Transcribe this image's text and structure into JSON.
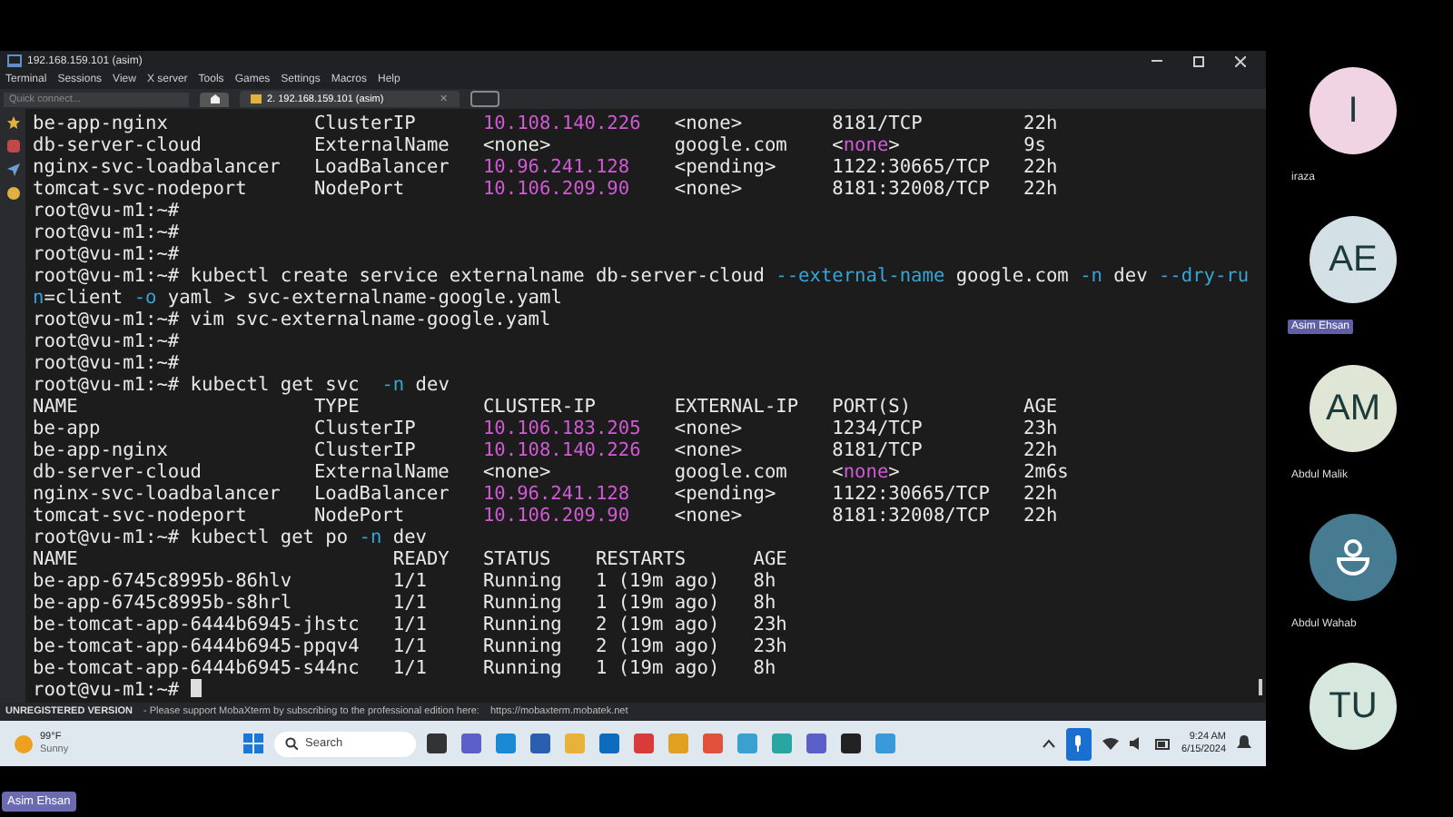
{
  "window": {
    "title": "192.168.159.101 (asim)",
    "menu": [
      "Terminal",
      "Sessions",
      "View",
      "X server",
      "Tools",
      "Games",
      "Settings",
      "Macros",
      "Help"
    ],
    "quick_connect": {
      "placeholder": "Quick connect..."
    },
    "tabs": [
      {
        "label": "2. 192.168.159.101 (asim)",
        "close": "✕",
        "selected": true
      }
    ],
    "terminal": {
      "lines": [
        [
          {
            "text": "be-app-nginx             ClusterIP      ",
            "kind": "plain"
          },
          {
            "text": "10.108.140.226",
            "kind": "ip"
          },
          {
            "text": "   <none>        8181/TCP         22h",
            "kind": "plain"
          }
        ],
        [
          {
            "text": "db-server-cloud          ExternalName   <none>           google.com    <",
            "kind": "plain"
          },
          {
            "text": "none",
            "kind": "ip"
          },
          {
            "text": ">           9s",
            "kind": "plain"
          }
        ],
        [
          {
            "text": "nginx-svc-loadbalancer   LoadBalancer   ",
            "kind": "plain"
          },
          {
            "text": "10.96.241.128",
            "kind": "ip"
          },
          {
            "text": "    <pending>     1122:30665/TCP   22h",
            "kind": "plain"
          }
        ],
        [
          {
            "text": "tomcat-svc-nodeport      NodePort       ",
            "kind": "plain"
          },
          {
            "text": "10.106.209.90",
            "kind": "ip"
          },
          {
            "text": "    <none>        8181:32008/TCP   22h",
            "kind": "plain"
          }
        ],
        [
          {
            "text": "root@vu-m1:~#",
            "kind": "plain"
          }
        ],
        [
          {
            "text": "root@vu-m1:~#",
            "kind": "plain"
          }
        ],
        [
          {
            "text": "root@vu-m1:~#",
            "kind": "plain"
          }
        ],
        [
          {
            "text": "root@vu-m1:~# kubectl create service externalname db-server-cloud ",
            "kind": "plain"
          },
          {
            "text": "--external-name",
            "kind": "flag"
          },
          {
            "text": " google.com ",
            "kind": "plain"
          },
          {
            "text": "-n",
            "kind": "flag"
          },
          {
            "text": " dev ",
            "kind": "plain"
          },
          {
            "text": "--dry-ru",
            "kind": "flag"
          }
        ],
        [
          {
            "text": "n",
            "kind": "flag"
          },
          {
            "text": "=client ",
            "kind": "plain"
          },
          {
            "text": "-o",
            "kind": "flag"
          },
          {
            "text": " yaml > svc-externalname-google.yaml",
            "kind": "plain"
          }
        ],
        [
          {
            "text": "root@vu-m1:~# vim svc-externalname-google.yaml",
            "kind": "plain"
          }
        ],
        [
          {
            "text": "root@vu-m1:~#",
            "kind": "plain"
          }
        ],
        [
          {
            "text": "root@vu-m1:~#",
            "kind": "plain"
          }
        ],
        [
          {
            "text": "root@vu-m1:~# kubectl get svc  ",
            "kind": "plain"
          },
          {
            "text": "-n",
            "kind": "flag"
          },
          {
            "text": " dev",
            "kind": "plain"
          }
        ],
        [
          {
            "text": "NAME                     TYPE           CLUSTER-IP       EXTERNAL-IP   PORT(S)          AGE",
            "kind": "plain"
          }
        ],
        [
          {
            "text": "be-app                   ClusterIP      ",
            "kind": "plain"
          },
          {
            "text": "10.106.183.205",
            "kind": "ip"
          },
          {
            "text": "   <none>        1234/TCP         23h",
            "kind": "plain"
          }
        ],
        [
          {
            "text": "be-app-nginx             ClusterIP      ",
            "kind": "plain"
          },
          {
            "text": "10.108.140.226",
            "kind": "ip"
          },
          {
            "text": "   <none>        8181/TCP         22h",
            "kind": "plain"
          }
        ],
        [
          {
            "text": "db-server-cloud          ExternalName   <none>           google.com    <",
            "kind": "plain"
          },
          {
            "text": "none",
            "kind": "ip"
          },
          {
            "text": ">           2m6s",
            "kind": "plain"
          }
        ],
        [
          {
            "text": "nginx-svc-loadbalancer   LoadBalancer   ",
            "kind": "plain"
          },
          {
            "text": "10.96.241.128",
            "kind": "ip"
          },
          {
            "text": "    <pending>     1122:30665/TCP   22h",
            "kind": "plain"
          }
        ],
        [
          {
            "text": "tomcat-svc-nodeport      NodePort       ",
            "kind": "plain"
          },
          {
            "text": "10.106.209.90",
            "kind": "ip"
          },
          {
            "text": "    <none>        8181:32008/TCP   22h",
            "kind": "plain"
          }
        ],
        [
          {
            "text": "root@vu-m1:~# kubectl get po ",
            "kind": "plain"
          },
          {
            "text": "-n",
            "kind": "flag"
          },
          {
            "text": " dev",
            "kind": "plain"
          }
        ],
        [
          {
            "text": "NAME                            READY   STATUS    RESTARTS      AGE",
            "kind": "plain"
          }
        ],
        [
          {
            "text": "be-app-6745c8995b-86hlv         1/1     Running   1 (19m ago)   8h",
            "kind": "plain"
          }
        ],
        [
          {
            "text": "be-app-6745c8995b-s8hrl         1/1     Running   1 (19m ago)   8h",
            "kind": "plain"
          }
        ],
        [
          {
            "text": "be-tomcat-app-6444b6945-jhstc   1/1     Running   2 (19m ago)   23h",
            "kind": "plain"
          }
        ],
        [
          {
            "text": "be-tomcat-app-6444b6945-ppqv4   1/1     Running   2 (19m ago)   23h",
            "kind": "plain"
          }
        ],
        [
          {
            "text": "be-tomcat-app-6444b6945-s44nc   1/1     Running   1 (19m ago)   8h",
            "kind": "plain"
          }
        ],
        [
          {
            "text": "root@vu-m1:~# ",
            "kind": "plain"
          },
          {
            "kind": "cursor"
          }
        ]
      ]
    },
    "status_bar": {
      "label": "UNREGISTERED VERSION",
      "message": "-  Please support MobaXterm by subscribing to the professional edition here:",
      "link": "https://mobaxterm.mobatek.net"
    }
  },
  "taskbar": {
    "weather": {
      "temperature": "99°F",
      "condition": "Sunny"
    },
    "search": {
      "placeholder": "Search"
    },
    "time": "9:24 AM",
    "date": "6/15/2024"
  },
  "presenter": "Asim Ehsan",
  "participants": [
    {
      "kind": "initials",
      "initials": "I",
      "name": "iraza",
      "color": "#f0d4e4",
      "highlighted": false
    },
    {
      "kind": "initials",
      "initials": "AE",
      "name": "Asim Ehsan",
      "color": "#d3e0e6",
      "highlighted": true
    },
    {
      "kind": "initials",
      "initials": "AM",
      "name": "Abdul Malik",
      "color": "#dfe6d6",
      "highlighted": false
    },
    {
      "kind": "silhouette",
      "name": "Abdul Wahab",
      "color": "#467b91",
      "highlighted": false
    },
    {
      "kind": "initials",
      "initials": "TU",
      "color": "#d6e8dd"
    }
  ]
}
